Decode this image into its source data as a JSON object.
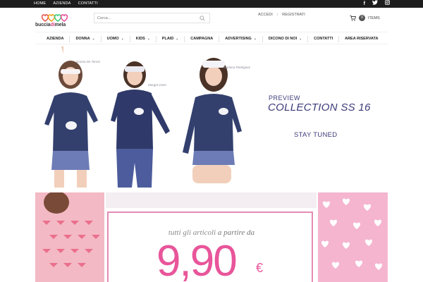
{
  "topbar": {
    "links": [
      "HOME",
      "AZIENDA",
      "CONTATTI"
    ],
    "social": [
      "f",
      "t",
      "ig"
    ]
  },
  "header": {
    "brand_left": "buccia",
    "brand_amp": "di",
    "brand_right": "mela",
    "search_placeholder": "Cerca...",
    "login": "ACCEDI",
    "register": "REGISTRATI",
    "cart_count": "0",
    "cart_label": "ITEMS"
  },
  "nav": {
    "items": [
      {
        "label": "AZIENDA",
        "dropdown": false
      },
      {
        "label": "DONNA",
        "dropdown": true
      },
      {
        "label": "UOMO",
        "dropdown": true
      },
      {
        "label": "KIDS",
        "dropdown": true
      },
      {
        "label": "PLAID",
        "dropdown": true
      },
      {
        "label": "CAMPAGNA",
        "dropdown": false
      },
      {
        "label": "ADVERTISING",
        "dropdown": true
      },
      {
        "label": "DICONO DI NOI",
        "dropdown": true
      },
      {
        "label": "CONTATTI",
        "dropdown": false
      },
      {
        "label": "AREA RISERVATA",
        "dropdown": false
      }
    ]
  },
  "hero": {
    "models": [
      "Gracia De Torres",
      "Margot Oven",
      "Mariana Rodriguez"
    ],
    "preview": "PREVIEW",
    "collection": "COLLECTION SS 16",
    "stay_tuned": "STAY TUNED"
  },
  "promo": {
    "line_italic_1": "tutti gli articoli",
    "line_plain": "a partire da",
    "price": "9,90",
    "currency": "€"
  },
  "colors": {
    "topbar": "#1d1d1d",
    "accent_pink": "#e8559a",
    "navy_text": "#3b3b7a"
  }
}
